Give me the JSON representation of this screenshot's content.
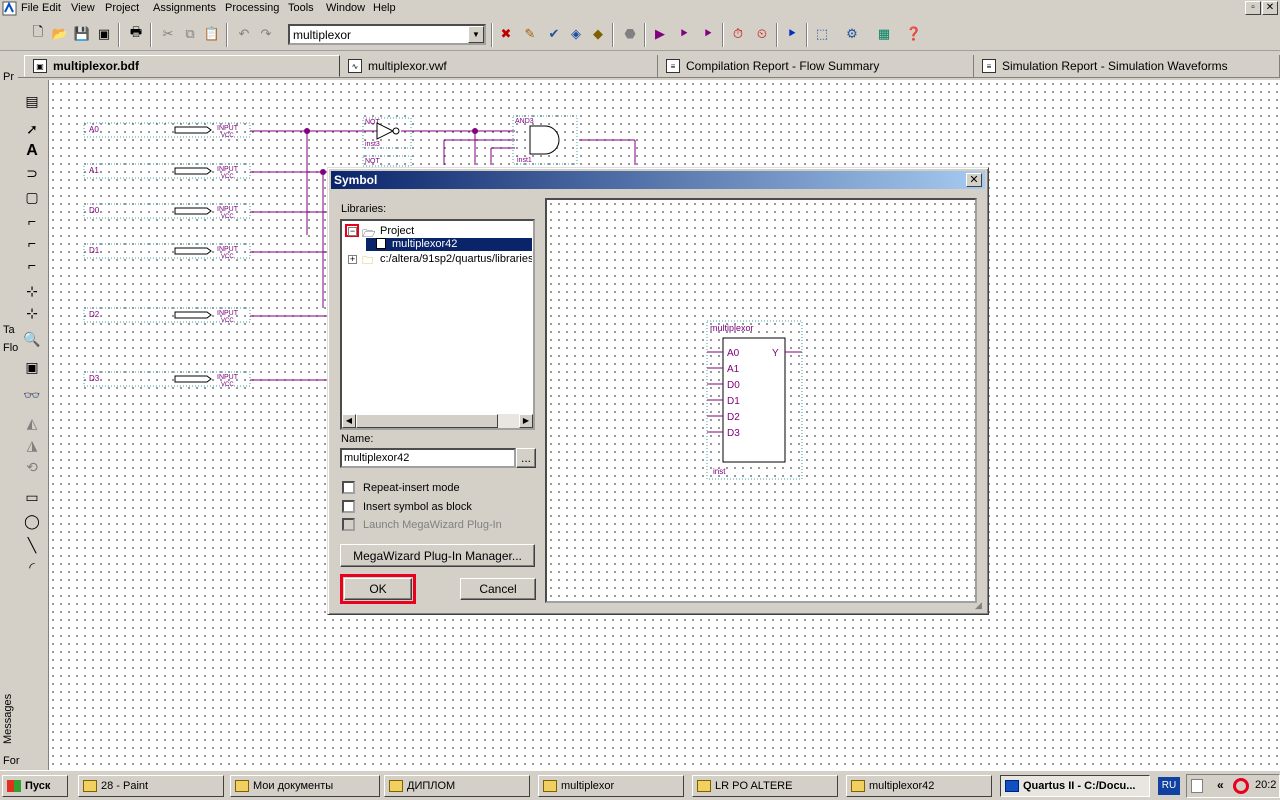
{
  "menubar": {
    "items": [
      "File",
      "Edit",
      "View",
      "Project",
      "Assignments",
      "Processing",
      "Tools",
      "Window",
      "Help"
    ]
  },
  "toolbar": {
    "entity_combo": "multiplexor"
  },
  "left_panel": {
    "labels": [
      "Pr",
      "Ta",
      "Flo",
      "Messages",
      "For"
    ]
  },
  "tabs": [
    {
      "label": "multiplexor.bdf",
      "icon": "bdf-file-icon"
    },
    {
      "label": "multiplexor.vwf",
      "icon": "waveform-file-icon"
    },
    {
      "label": "Compilation Report - Flow Summary",
      "icon": "report-icon"
    },
    {
      "label": "Simulation Report - Simulation Waveforms",
      "icon": "report-icon"
    }
  ],
  "schematic": {
    "inputs": [
      {
        "name": "A0",
        "type": "INPUT",
        "sub": "VCC"
      },
      {
        "name": "A1",
        "type": "INPUT",
        "sub": "VCC"
      },
      {
        "name": "D0",
        "type": "INPUT",
        "sub": "VCC"
      },
      {
        "name": "D1",
        "type": "INPUT",
        "sub": "VCC"
      },
      {
        "name": "D2",
        "type": "INPUT",
        "sub": "VCC"
      },
      {
        "name": "D3",
        "type": "INPUT",
        "sub": "VCC"
      }
    ],
    "not_gate": {
      "type": "NOT",
      "inst": "inst3"
    },
    "not_gate2": {
      "type": "NOT"
    },
    "and_gate": {
      "type": "AND3",
      "inst": "inst1"
    }
  },
  "dialog": {
    "title": "Symbol",
    "libraries_label": "Libraries:",
    "tree": {
      "project": "Project",
      "selected_item": "multiplexor42",
      "library_path": "c:/altera/91sp2/quartus/libraries"
    },
    "name_label": "Name:",
    "name_value": "multiplexor42",
    "browse_label": "...",
    "checkboxes": [
      {
        "label": "Repeat-insert mode",
        "checked": false,
        "disabled": false
      },
      {
        "label": "Insert symbol as block",
        "checked": false,
        "disabled": false
      },
      {
        "label": "Launch MegaWizard Plug-In",
        "checked": false,
        "disabled": true
      }
    ],
    "megawizard_button": "MegaWizard Plug-In Manager...",
    "ok_button": "OK",
    "cancel_button": "Cancel",
    "preview": {
      "symbol_name": "multiplexor",
      "inputs": [
        "A0",
        "A1",
        "D0",
        "D1",
        "D2",
        "D3"
      ],
      "output": "Y",
      "inst": "inst"
    }
  },
  "taskbar": {
    "start": "Пуск",
    "tasks": [
      {
        "label": "28 - Paint"
      },
      {
        "label": "Мои документы"
      },
      {
        "label": "ДИПЛОМ"
      },
      {
        "label": "multiplexor"
      },
      {
        "label": "LR PO ALTERE"
      },
      {
        "label": "multiplexor42"
      },
      {
        "label": "Quartus II - C:/Docu..."
      }
    ],
    "lang": "RU",
    "chevron": "«",
    "time": "20:2"
  },
  "colors": {
    "highlight_red": "#e8001c",
    "wire_purple": "#800080",
    "title_blue": "#0a246a"
  }
}
